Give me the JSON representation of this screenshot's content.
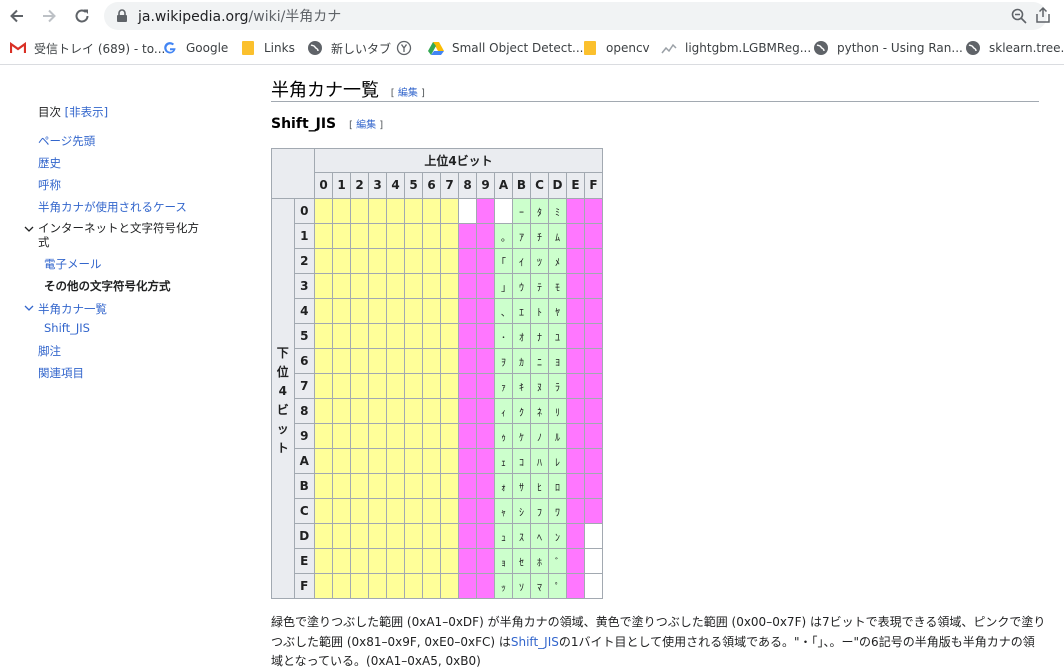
{
  "browser": {
    "url_host": "ja.wikipedia.org",
    "url_path": "/wiki/半角カナ",
    "bookmarks": [
      {
        "label": "受信トレイ (689) - to...",
        "icon": "gmail-icon"
      },
      {
        "label": "Google",
        "icon": "google-icon"
      },
      {
        "label": "Links",
        "icon": "folder-icon"
      },
      {
        "label": "新しいタブ",
        "icon": "globe-icon"
      },
      {
        "label": "",
        "icon": "y-circle-icon"
      },
      {
        "label": "Small Object Detect...",
        "icon": "drive-icon"
      },
      {
        "label": "opencv",
        "icon": "folder-icon"
      },
      {
        "label": "lightgbm.LGBMReg...",
        "icon": "chart-icon"
      },
      {
        "label": "python - Using Ran...",
        "icon": "globe-icon"
      },
      {
        "label": "sklearn.tree.De",
        "icon": "globe-icon"
      }
    ]
  },
  "toc": {
    "title": "目次",
    "hide_label": "[非表示]",
    "items": [
      {
        "label": "ページ先頭"
      },
      {
        "label": "歴史"
      },
      {
        "label": "呼称"
      },
      {
        "label": "半角カナが使用されるケース"
      },
      {
        "label": "インターネットと文字符号化方式"
      },
      {
        "label": "電子メール"
      },
      {
        "label": "その他の文字符号化方式"
      },
      {
        "label": "半角カナ一覧"
      },
      {
        "label": "Shift_JIS"
      },
      {
        "label": "脚注"
      },
      {
        "label": "関連項目"
      }
    ]
  },
  "article": {
    "h1": "半角カナ一覧",
    "h2": "Shift_JIS",
    "edit_label": "編集",
    "table": {
      "top_header": "上位4ビット",
      "side_header": "下位4ビット",
      "cols": [
        "0",
        "1",
        "2",
        "3",
        "4",
        "5",
        "6",
        "7",
        "8",
        "9",
        "A",
        "B",
        "C",
        "D",
        "E",
        "F"
      ],
      "rows": [
        "0",
        "1",
        "2",
        "3",
        "4",
        "5",
        "6",
        "7",
        "8",
        "9",
        "A",
        "B",
        "C",
        "D",
        "E",
        "F"
      ],
      "colA": [
        "",
        "｡",
        "｢",
        "｣",
        "､",
        "･",
        "ｦ",
        "ｧ",
        "ｨ",
        "ｩ",
        "ｪ",
        "ｫ",
        "ｬ",
        "ｭ",
        "ｮ",
        "ｯ"
      ],
      "colB": [
        "ｰ",
        "ｱ",
        "ｲ",
        "ｳ",
        "ｴ",
        "ｵ",
        "ｶ",
        "ｷ",
        "ｸ",
        "ｹ",
        "ｺ",
        "ｻ",
        "ｼ",
        "ｽ",
        "ｾ",
        "ｿ"
      ],
      "colC": [
        "ﾀ",
        "ﾁ",
        "ﾂ",
        "ﾃ",
        "ﾄ",
        "ﾅ",
        "ﾆ",
        "ﾇ",
        "ﾈ",
        "ﾉ",
        "ﾊ",
        "ﾋ",
        "ﾌ",
        "ﾍ",
        "ﾎ",
        "ﾏ"
      ],
      "colD": [
        "ﾐ",
        "ﾑ",
        "ﾒ",
        "ﾓ",
        "ﾔ",
        "ﾕ",
        "ﾖ",
        "ﾗ",
        "ﾘ",
        "ﾙ",
        "ﾚ",
        "ﾛ",
        "ﾜ",
        "ﾝ",
        "ﾞ",
        "ﾟ"
      ],
      "colors": {
        "green": "#ccffcc",
        "yellow": "#ffff99",
        "pink": "#ff77ff"
      }
    },
    "caption_part1": "緑色で塗りつぶした範囲 (0xA1–0xDF) が半角カナの領域、黄色で塗りつぶした範囲 (0x00–0x7F) は7ビットで表現できる領域、ピンクで塗りつぶした範囲 (0x81–0x9F, 0xE0–0xFC) は",
    "caption_link": "Shift_JIS",
    "caption_part2": "の1バイト目として使用される領域である。\"・「」、。ー\"の6記号の半角版も半角カナの領域となっている。(0xA1–0xA5, 0xB0)"
  }
}
